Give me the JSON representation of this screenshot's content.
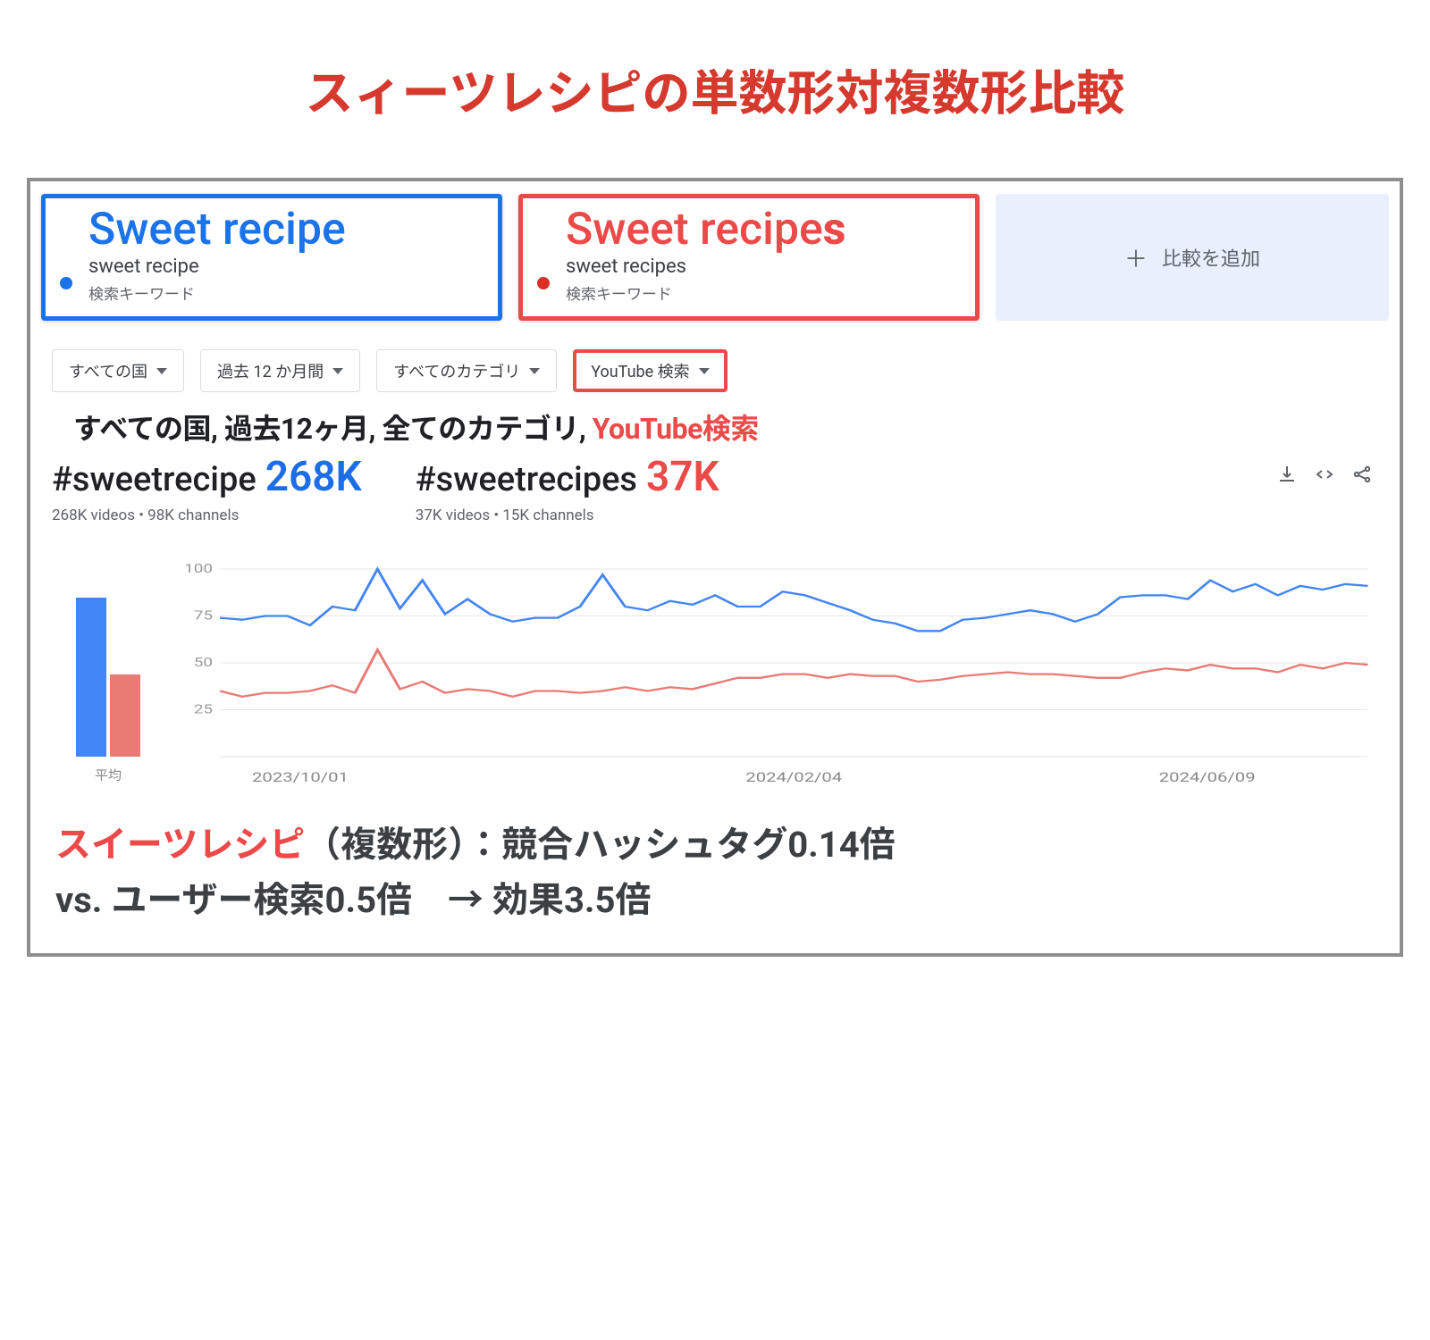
{
  "page_title": "スィーツレシピの単数形対複数形比較",
  "compare": {
    "a": {
      "title": "Sweet recipe",
      "term": "sweet recipe",
      "sub": "検索キーワード"
    },
    "b": {
      "title_prefix": "Sweet recipe",
      "title_suffix": "s",
      "term": "sweet recipes",
      "sub": "検索キーワード"
    },
    "add": {
      "plus": "＋",
      "label": "比較を追加"
    }
  },
  "filters": {
    "country": "すべての国",
    "period": "過去 12 か月間",
    "category": "すべてのカテゴリ",
    "source": "YouTube 検索"
  },
  "anno": {
    "p1": "すべての国",
    "c1": ",",
    "p2": "過去12ヶ月",
    "c2": ",",
    "p3": "全てのカテゴリ",
    "c3": ",",
    "p4": "YouTube検索"
  },
  "hashtags": {
    "a": {
      "tag": "#sweetrecipe",
      "count": "268K",
      "sub": "268K videos • 98K channels"
    },
    "b": {
      "tag": "#sweetrecipes",
      "count": "37K",
      "sub": "37K videos • 15K channels"
    }
  },
  "avg_label": "平均",
  "chart_data": {
    "type": "line",
    "ylim": [
      0,
      100
    ],
    "y_ticks": [
      25,
      50,
      75,
      100
    ],
    "x_labels": [
      "2023/10/01",
      "2024/02/04",
      "2024/06/09"
    ],
    "avg": {
      "blue": 81,
      "red": 42
    },
    "series": [
      {
        "name": "sweet recipe",
        "color": "#4285f4",
        "values": [
          74,
          73,
          75,
          75,
          70,
          80,
          78,
          100,
          79,
          94,
          76,
          84,
          76,
          72,
          74,
          74,
          80,
          97,
          80,
          78,
          83,
          81,
          86,
          80,
          80,
          88,
          86,
          82,
          78,
          73,
          71,
          67,
          67,
          73,
          74,
          76,
          78,
          76,
          72,
          76,
          85,
          86,
          86,
          84,
          94,
          88,
          92,
          86,
          91,
          89,
          92,
          91
        ]
      },
      {
        "name": "sweet recipes",
        "color": "#ea7a74",
        "values": [
          35,
          32,
          34,
          34,
          35,
          38,
          34,
          57,
          36,
          40,
          34,
          36,
          35,
          32,
          35,
          35,
          34,
          35,
          37,
          35,
          37,
          36,
          39,
          42,
          42,
          44,
          44,
          42,
          44,
          43,
          43,
          40,
          41,
          43,
          44,
          45,
          44,
          44,
          43,
          42,
          42,
          45,
          47,
          46,
          49,
          47,
          47,
          45,
          49,
          47,
          50,
          49
        ]
      }
    ]
  },
  "bottom": {
    "s1": "スイーツレシピ",
    "s2": "（複数形）：競合ハッシュタグ0.14倍",
    "s3": "vs. ユーザー検索0.5倍　→ 効果3.5倍"
  }
}
